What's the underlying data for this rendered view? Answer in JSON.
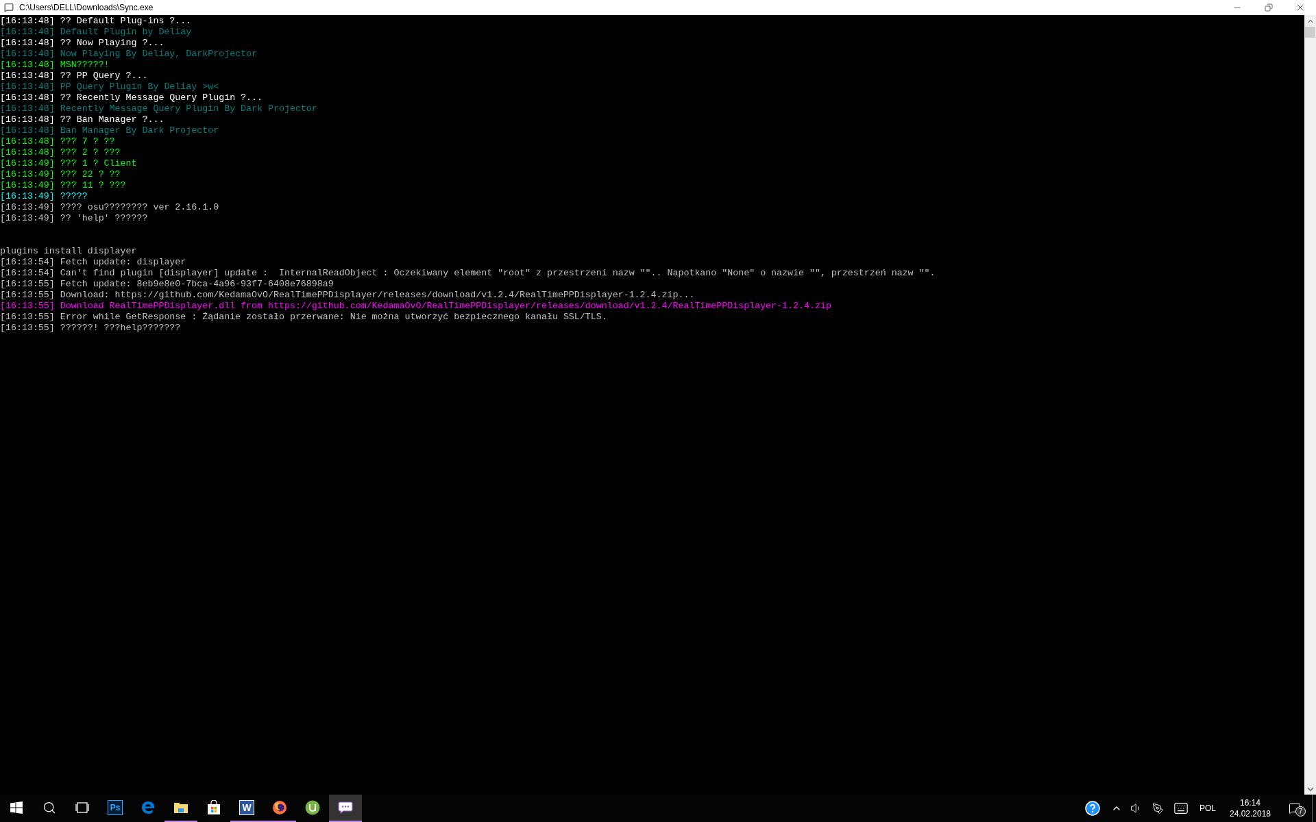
{
  "window": {
    "title": "C:\\Users\\DELL\\Downloads\\Sync.exe"
  },
  "console": {
    "lines": [
      {
        "kind": "log",
        "text": "[16:13:48] ?? Default Plug-ins ?...",
        "color": "#ffffff"
      },
      {
        "kind": "log",
        "text": "[16:13:48] Default Plugin by Deliay",
        "color": "#008080"
      },
      {
        "kind": "log",
        "text": "[16:13:48] ?? Now Playing ?...",
        "color": "#ffffff"
      },
      {
        "kind": "log",
        "text": "[16:13:48] Now Playing By Deliay, DarkProjector",
        "color": "#008080"
      },
      {
        "kind": "log",
        "text": "[16:13:48] MSN?????!",
        "color": "#00ff00"
      },
      {
        "kind": "log",
        "text": "[16:13:48] ?? PP Query ?...",
        "color": "#ffffff"
      },
      {
        "kind": "log",
        "text": "[16:13:48] PP Query Plugin By Deliay >w<",
        "color": "#008080"
      },
      {
        "kind": "log",
        "text": "[16:13:48] ?? Recently Message Query Plugin ?...",
        "color": "#ffffff"
      },
      {
        "kind": "log",
        "text": "[16:13:48] Recently Message Query Plugin By Dark Projector",
        "color": "#008080"
      },
      {
        "kind": "log",
        "text": "[16:13:48] ?? Ban Manager ?...",
        "color": "#ffffff"
      },
      {
        "kind": "log",
        "text": "[16:13:48] Ban Manager By Dark Projector",
        "color": "#008080"
      },
      {
        "kind": "log",
        "text": "[16:13:48] ??? 7 ? ??",
        "color": "#00ff00"
      },
      {
        "kind": "log",
        "text": "[16:13:48] ??? 2 ? ???",
        "color": "#00ff00"
      },
      {
        "kind": "log",
        "text": "[16:13:49] ??? 1 ? Client",
        "color": "#00ff00"
      },
      {
        "kind": "log",
        "text": "[16:13:49] ??? 22 ? ??",
        "color": "#00ff00"
      },
      {
        "kind": "log",
        "text": "[16:13:49] ??? 11 ? ???",
        "color": "#00ff00"
      },
      {
        "kind": "log",
        "text": "[16:13:49] ?????",
        "color": "#00ffff"
      },
      {
        "kind": "log",
        "text": "[16:13:49] ???? osu???????? ver 2.16.1.0",
        "color": "#c0c0c0"
      },
      {
        "kind": "log",
        "text": "[16:13:49] ?? 'help' ??????",
        "color": "#c0c0c0"
      },
      {
        "kind": "command",
        "text": "plugins install displayer",
        "color": "#c0c0c0"
      },
      {
        "kind": "log",
        "text": "[16:13:54] Fetch update: displayer",
        "color": "#c0c0c0"
      },
      {
        "kind": "log",
        "text": "[16:13:54] Can't find plugin [displayer] update :  InternalReadObject : Oczekiwany element \"root\" z przestrzeni nazw \"\".. Napotkano \"None\" o nazwie \"\", przestrzeń nazw \"\".",
        "color": "#c0c0c0"
      },
      {
        "kind": "log",
        "text": "[16:13:55] Fetch update: 8eb9e8e0-7bca-4a96-93f7-6408e76898a9",
        "color": "#c0c0c0"
      },
      {
        "kind": "log",
        "text": "[16:13:55] Download: https://github.com/KedamaOvO/RealTimePPDisplayer/releases/download/v1.2.4/RealTimePPDisplayer-1.2.4.zip...",
        "color": "#c0c0c0"
      },
      {
        "kind": "log",
        "text": "[16:13:55] Download RealTimePPDisplayer.dll from https://github.com/KedamaOvO/RealTimePPDisplayer/releases/download/v1.2.4/RealTimePPDisplayer-1.2.4.zip",
        "color": "#ff00ff"
      },
      {
        "kind": "log",
        "text": "[16:13:55] Error while GetResponse : Żądanie zostało przerwane: Nie można utworzyć bezpiecznego kanału SSL/TLS.",
        "color": "#c0c0c0"
      },
      {
        "kind": "log",
        "text": "[16:13:55] ??????! ???help???????",
        "color": "#c0c0c0"
      }
    ]
  },
  "taskbar": {
    "items": [
      {
        "kind": "start",
        "running": false,
        "selected": false
      },
      {
        "kind": "search",
        "running": false,
        "selected": false
      },
      {
        "kind": "taskview",
        "running": false,
        "selected": false
      },
      {
        "kind": "photoshop",
        "label": "Ps",
        "running": false,
        "selected": false
      },
      {
        "kind": "edge",
        "running": false,
        "selected": false
      },
      {
        "kind": "explorer",
        "running": true,
        "selected": false
      },
      {
        "kind": "store",
        "running": false,
        "selected": false
      },
      {
        "kind": "word",
        "label": "W",
        "running": true,
        "selected": false
      },
      {
        "kind": "firefox",
        "running": true,
        "selected": false
      },
      {
        "kind": "torrent",
        "running": false,
        "selected": false
      },
      {
        "kind": "console",
        "running": true,
        "selected": true
      }
    ],
    "tray": {
      "language": "POL",
      "time": "16:14",
      "date": "24.02.2018",
      "notifications": "7"
    }
  }
}
